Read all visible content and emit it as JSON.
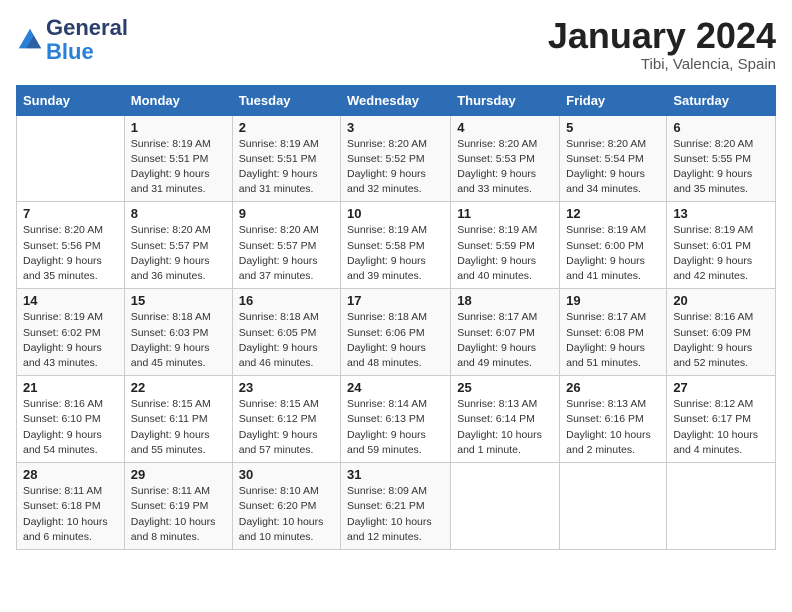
{
  "header": {
    "logo_general": "General",
    "logo_blue": "Blue",
    "month_title": "January 2024",
    "location": "Tibi, Valencia, Spain"
  },
  "days_of_week": [
    "Sunday",
    "Monday",
    "Tuesday",
    "Wednesday",
    "Thursday",
    "Friday",
    "Saturday"
  ],
  "weeks": [
    [
      {
        "day": "",
        "sunrise": "",
        "sunset": "",
        "daylight": ""
      },
      {
        "day": "1",
        "sunrise": "Sunrise: 8:19 AM",
        "sunset": "Sunset: 5:51 PM",
        "daylight": "Daylight: 9 hours and 31 minutes."
      },
      {
        "day": "2",
        "sunrise": "Sunrise: 8:19 AM",
        "sunset": "Sunset: 5:51 PM",
        "daylight": "Daylight: 9 hours and 31 minutes."
      },
      {
        "day": "3",
        "sunrise": "Sunrise: 8:20 AM",
        "sunset": "Sunset: 5:52 PM",
        "daylight": "Daylight: 9 hours and 32 minutes."
      },
      {
        "day": "4",
        "sunrise": "Sunrise: 8:20 AM",
        "sunset": "Sunset: 5:53 PM",
        "daylight": "Daylight: 9 hours and 33 minutes."
      },
      {
        "day": "5",
        "sunrise": "Sunrise: 8:20 AM",
        "sunset": "Sunset: 5:54 PM",
        "daylight": "Daylight: 9 hours and 34 minutes."
      },
      {
        "day": "6",
        "sunrise": "Sunrise: 8:20 AM",
        "sunset": "Sunset: 5:55 PM",
        "daylight": "Daylight: 9 hours and 35 minutes."
      }
    ],
    [
      {
        "day": "7",
        "sunrise": "Sunrise: 8:20 AM",
        "sunset": "Sunset: 5:56 PM",
        "daylight": "Daylight: 9 hours and 35 minutes."
      },
      {
        "day": "8",
        "sunrise": "Sunrise: 8:20 AM",
        "sunset": "Sunset: 5:57 PM",
        "daylight": "Daylight: 9 hours and 36 minutes."
      },
      {
        "day": "9",
        "sunrise": "Sunrise: 8:20 AM",
        "sunset": "Sunset: 5:57 PM",
        "daylight": "Daylight: 9 hours and 37 minutes."
      },
      {
        "day": "10",
        "sunrise": "Sunrise: 8:19 AM",
        "sunset": "Sunset: 5:58 PM",
        "daylight": "Daylight: 9 hours and 39 minutes."
      },
      {
        "day": "11",
        "sunrise": "Sunrise: 8:19 AM",
        "sunset": "Sunset: 5:59 PM",
        "daylight": "Daylight: 9 hours and 40 minutes."
      },
      {
        "day": "12",
        "sunrise": "Sunrise: 8:19 AM",
        "sunset": "Sunset: 6:00 PM",
        "daylight": "Daylight: 9 hours and 41 minutes."
      },
      {
        "day": "13",
        "sunrise": "Sunrise: 8:19 AM",
        "sunset": "Sunset: 6:01 PM",
        "daylight": "Daylight: 9 hours and 42 minutes."
      }
    ],
    [
      {
        "day": "14",
        "sunrise": "Sunrise: 8:19 AM",
        "sunset": "Sunset: 6:02 PM",
        "daylight": "Daylight: 9 hours and 43 minutes."
      },
      {
        "day": "15",
        "sunrise": "Sunrise: 8:18 AM",
        "sunset": "Sunset: 6:03 PM",
        "daylight": "Daylight: 9 hours and 45 minutes."
      },
      {
        "day": "16",
        "sunrise": "Sunrise: 8:18 AM",
        "sunset": "Sunset: 6:05 PM",
        "daylight": "Daylight: 9 hours and 46 minutes."
      },
      {
        "day": "17",
        "sunrise": "Sunrise: 8:18 AM",
        "sunset": "Sunset: 6:06 PM",
        "daylight": "Daylight: 9 hours and 48 minutes."
      },
      {
        "day": "18",
        "sunrise": "Sunrise: 8:17 AM",
        "sunset": "Sunset: 6:07 PM",
        "daylight": "Daylight: 9 hours and 49 minutes."
      },
      {
        "day": "19",
        "sunrise": "Sunrise: 8:17 AM",
        "sunset": "Sunset: 6:08 PM",
        "daylight": "Daylight: 9 hours and 51 minutes."
      },
      {
        "day": "20",
        "sunrise": "Sunrise: 8:16 AM",
        "sunset": "Sunset: 6:09 PM",
        "daylight": "Daylight: 9 hours and 52 minutes."
      }
    ],
    [
      {
        "day": "21",
        "sunrise": "Sunrise: 8:16 AM",
        "sunset": "Sunset: 6:10 PM",
        "daylight": "Daylight: 9 hours and 54 minutes."
      },
      {
        "day": "22",
        "sunrise": "Sunrise: 8:15 AM",
        "sunset": "Sunset: 6:11 PM",
        "daylight": "Daylight: 9 hours and 55 minutes."
      },
      {
        "day": "23",
        "sunrise": "Sunrise: 8:15 AM",
        "sunset": "Sunset: 6:12 PM",
        "daylight": "Daylight: 9 hours and 57 minutes."
      },
      {
        "day": "24",
        "sunrise": "Sunrise: 8:14 AM",
        "sunset": "Sunset: 6:13 PM",
        "daylight": "Daylight: 9 hours and 59 minutes."
      },
      {
        "day": "25",
        "sunrise": "Sunrise: 8:13 AM",
        "sunset": "Sunset: 6:14 PM",
        "daylight": "Daylight: 10 hours and 1 minute."
      },
      {
        "day": "26",
        "sunrise": "Sunrise: 8:13 AM",
        "sunset": "Sunset: 6:16 PM",
        "daylight": "Daylight: 10 hours and 2 minutes."
      },
      {
        "day": "27",
        "sunrise": "Sunrise: 8:12 AM",
        "sunset": "Sunset: 6:17 PM",
        "daylight": "Daylight: 10 hours and 4 minutes."
      }
    ],
    [
      {
        "day": "28",
        "sunrise": "Sunrise: 8:11 AM",
        "sunset": "Sunset: 6:18 PM",
        "daylight": "Daylight: 10 hours and 6 minutes."
      },
      {
        "day": "29",
        "sunrise": "Sunrise: 8:11 AM",
        "sunset": "Sunset: 6:19 PM",
        "daylight": "Daylight: 10 hours and 8 minutes."
      },
      {
        "day": "30",
        "sunrise": "Sunrise: 8:10 AM",
        "sunset": "Sunset: 6:20 PM",
        "daylight": "Daylight: 10 hours and 10 minutes."
      },
      {
        "day": "31",
        "sunrise": "Sunrise: 8:09 AM",
        "sunset": "Sunset: 6:21 PM",
        "daylight": "Daylight: 10 hours and 12 minutes."
      },
      {
        "day": "",
        "sunrise": "",
        "sunset": "",
        "daylight": ""
      },
      {
        "day": "",
        "sunrise": "",
        "sunset": "",
        "daylight": ""
      },
      {
        "day": "",
        "sunrise": "",
        "sunset": "",
        "daylight": ""
      }
    ]
  ]
}
